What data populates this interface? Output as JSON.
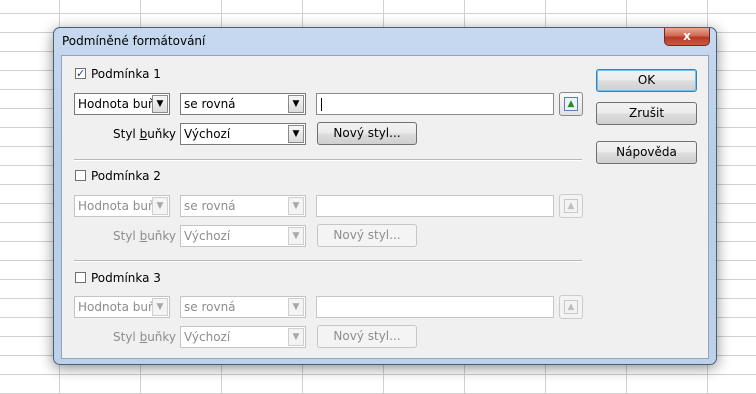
{
  "dialog": {
    "title": "Podmíněné formátování",
    "close_label": "x"
  },
  "conditions": [
    {
      "checked": true,
      "label": "Podmínka 1",
      "type_value": "Hodnota buňky",
      "operator_value": "se rovná",
      "value_text": "",
      "style_label": "Styl buňky",
      "style_value": "Výchozí",
      "new_style_label": "Nový styl..."
    },
    {
      "checked": false,
      "label": "Podmínka 2",
      "type_value": "Hodnota buňky",
      "operator_value": "se rovná",
      "value_text": "",
      "style_label": "Styl buňky",
      "style_value": "Výchozí",
      "new_style_label": "Nový styl..."
    },
    {
      "checked": false,
      "label": "Podmínka 3",
      "type_value": "Hodnota buňky",
      "operator_value": "se rovná",
      "value_text": "",
      "style_label": "Styl buňky",
      "style_value": "Výchozí",
      "new_style_label": "Nový styl..."
    }
  ],
  "buttons": {
    "ok": "OK",
    "cancel": "Zrušit",
    "help": "Nápověda"
  },
  "icons": {
    "checkmark": "check-icon",
    "dropdown": "chevron-down-icon",
    "shrink": "shrink-dialog-icon",
    "close": "close-icon"
  }
}
